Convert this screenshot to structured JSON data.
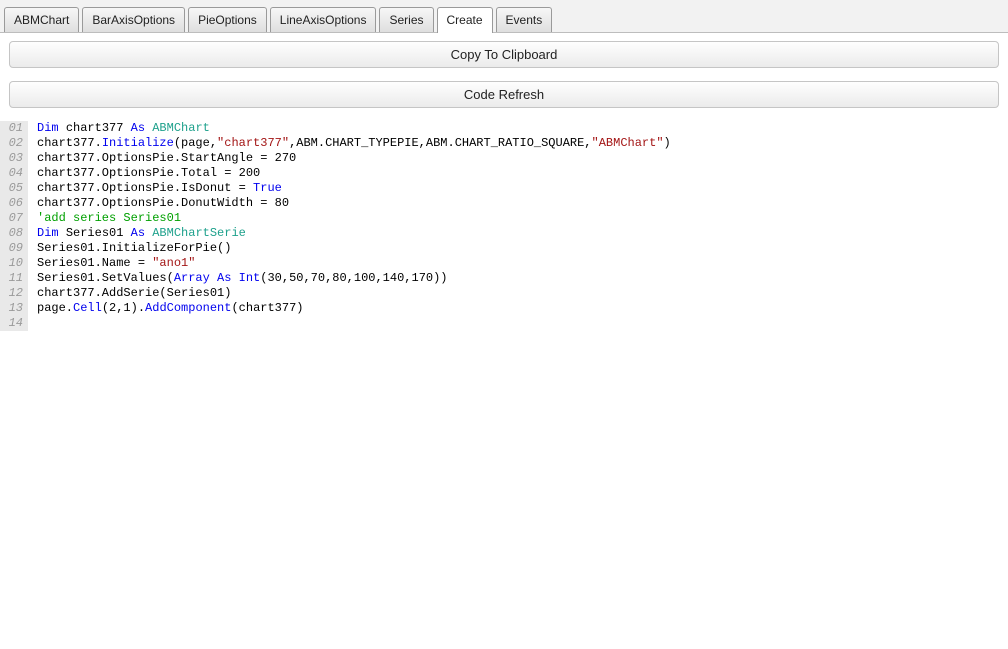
{
  "tabs": [
    {
      "label": "ABMChart",
      "active": false
    },
    {
      "label": "BarAxisOptions",
      "active": false
    },
    {
      "label": "PieOptions",
      "active": false
    },
    {
      "label": "LineAxisOptions",
      "active": false
    },
    {
      "label": "Series",
      "active": false
    },
    {
      "label": "Create",
      "active": true
    },
    {
      "label": "Events",
      "active": false
    }
  ],
  "buttons": {
    "copy": "Copy To Clipboard",
    "refresh": "Code Refresh"
  },
  "code": {
    "lines": [
      {
        "num": "01",
        "segs": [
          [
            "k",
            "Dim "
          ],
          [
            "p",
            "chart377 "
          ],
          [
            "k",
            "As "
          ],
          [
            "t",
            "ABMChart"
          ]
        ]
      },
      {
        "num": "02",
        "segs": [
          [
            "p",
            "chart377."
          ],
          [
            "k",
            "Initialize"
          ],
          [
            "p",
            "(page,"
          ],
          [
            "s",
            "\"chart377\""
          ],
          [
            "p",
            ",ABM.CHART_TYPEPIE,ABM.CHART_RATIO_SQUARE,"
          ],
          [
            "s",
            "\"ABMChart\""
          ],
          [
            "p",
            ")"
          ]
        ]
      },
      {
        "num": "03",
        "segs": [
          [
            "p",
            "chart377.OptionsPie.StartAngle = 270"
          ]
        ]
      },
      {
        "num": "04",
        "segs": [
          [
            "p",
            "chart377.OptionsPie.Total = 200"
          ]
        ]
      },
      {
        "num": "05",
        "segs": [
          [
            "p",
            "chart377.OptionsPie.IsDonut = "
          ],
          [
            "k",
            "True"
          ]
        ]
      },
      {
        "num": "06",
        "segs": [
          [
            "p",
            "chart377.OptionsPie.DonutWidth = 80"
          ]
        ]
      },
      {
        "num": "07",
        "segs": [
          [
            "c",
            "'add series Series01"
          ]
        ]
      },
      {
        "num": "08",
        "segs": [
          [
            "k",
            "Dim "
          ],
          [
            "p",
            "Series01 "
          ],
          [
            "k",
            "As "
          ],
          [
            "t",
            "ABMChartSerie"
          ]
        ]
      },
      {
        "num": "09",
        "segs": [
          [
            "p",
            "Series01.InitializeForPie()"
          ]
        ]
      },
      {
        "num": "10",
        "segs": [
          [
            "p",
            "Series01.Name = "
          ],
          [
            "s",
            "\"ano1\""
          ]
        ]
      },
      {
        "num": "11",
        "segs": [
          [
            "p",
            "Series01.SetValues("
          ],
          [
            "k",
            "Array"
          ],
          [
            "p",
            " "
          ],
          [
            "k",
            "As"
          ],
          [
            "p",
            " "
          ],
          [
            "k",
            "Int"
          ],
          [
            "p",
            "(30,50,70,80,100,140,170))"
          ]
        ]
      },
      {
        "num": "12",
        "segs": [
          [
            "p",
            "chart377.AddSerie(Series01)"
          ]
        ]
      },
      {
        "num": "13",
        "segs": [
          [
            "p",
            "page."
          ],
          [
            "k",
            "Cell"
          ],
          [
            "p",
            "(2,1)."
          ],
          [
            "k",
            "AddComponent"
          ],
          [
            "p",
            "(chart377)"
          ]
        ]
      },
      {
        "num": "14",
        "segs": []
      }
    ]
  }
}
